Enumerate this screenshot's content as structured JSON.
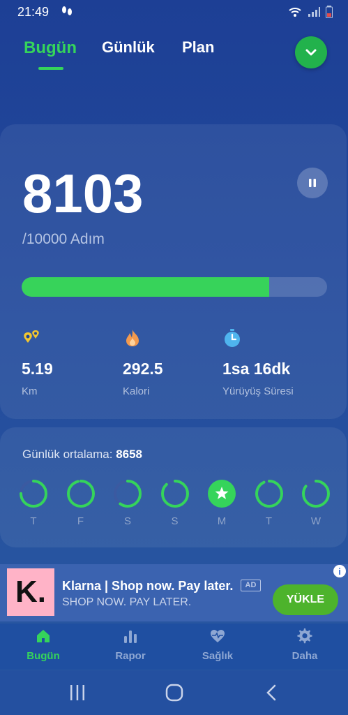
{
  "status_bar": {
    "time": "21:49",
    "icons": [
      "footsteps-icon",
      "wifi-icon",
      "signal-icon",
      "battery-icon"
    ]
  },
  "tabs": [
    {
      "label": "Bugün",
      "active": true
    },
    {
      "label": "Günlük",
      "active": false
    },
    {
      "label": "Plan",
      "active": false
    }
  ],
  "steps": {
    "count": "8103",
    "goal": "/10000 Adım",
    "progress": 0.81
  },
  "stats": [
    {
      "value": "5.19",
      "label": "Km",
      "icon": "location-pins-icon"
    },
    {
      "value": "292.5",
      "label": "Kalori",
      "icon": "flame-icon"
    },
    {
      "value": "1sa 16dk",
      "label": "Yürüyüş Süresi",
      "icon": "stopwatch-icon"
    }
  ],
  "weekly": {
    "average_label": "Günlük ortalama:",
    "average_value": "8658",
    "days": [
      {
        "label": "T",
        "progress": 0.75,
        "completed": false
      },
      {
        "label": "F",
        "progress": 0.96,
        "completed": false
      },
      {
        "label": "S",
        "progress": 0.6,
        "completed": false
      },
      {
        "label": "S",
        "progress": 0.88,
        "completed": false
      },
      {
        "label": "M",
        "progress": 1.0,
        "completed": true
      },
      {
        "label": "T",
        "progress": 0.93,
        "completed": false
      },
      {
        "label": "W",
        "progress": 0.85,
        "completed": false
      }
    ]
  },
  "ad": {
    "logo_text": "K.",
    "title": "Klarna | Shop now. Pay later.",
    "badge": "AD",
    "subtitle": "SHOP NOW. PAY LATER.",
    "cta": "YÜKLE"
  },
  "bottom_nav": [
    {
      "label": "Bugün",
      "icon": "home-icon",
      "active": true
    },
    {
      "label": "Rapor",
      "icon": "bar-chart-icon",
      "active": false
    },
    {
      "label": "Sağlık",
      "icon": "heart-pulse-icon",
      "active": false
    },
    {
      "label": "Daha",
      "icon": "gear-icon",
      "active": false
    }
  ],
  "colors": {
    "accent_green": "#35d45b",
    "background_blue": "#234b9c",
    "progress_track": "#3a5ea8",
    "day_ring_track": "#3b5aa1"
  }
}
